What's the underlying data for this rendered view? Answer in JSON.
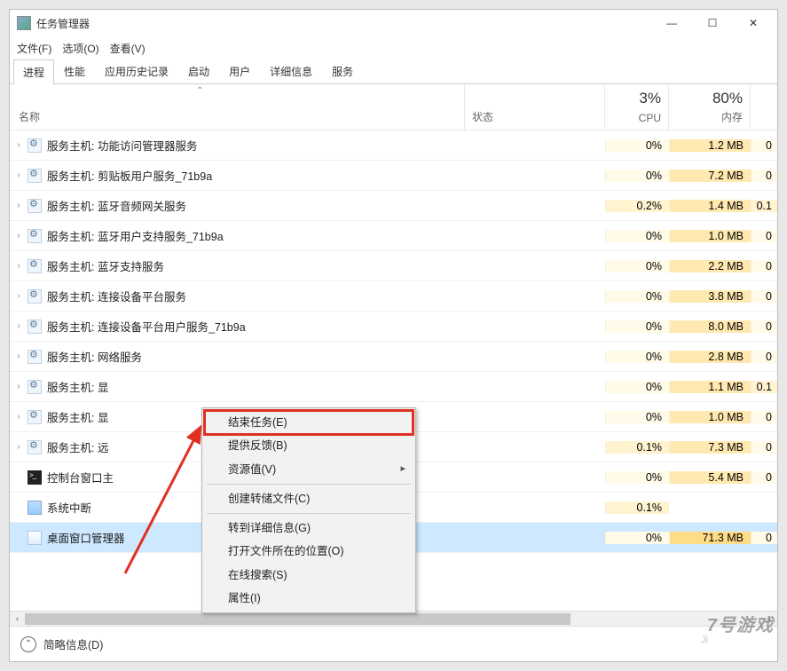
{
  "window": {
    "title": "任务管理器"
  },
  "menubar": [
    "文件(F)",
    "选项(O)",
    "查看(V)"
  ],
  "tabs": [
    "进程",
    "性能",
    "应用历史记录",
    "启动",
    "用户",
    "详细信息",
    "服务"
  ],
  "active_tab": 0,
  "headers": {
    "name": "名称",
    "status": "状态",
    "cpu_val": "3%",
    "cpu_lbl": "CPU",
    "mem_val": "80%",
    "mem_lbl": "内存"
  },
  "rows": [
    {
      "icon": "gear",
      "name": "服务主机: 功能访问管理器服务",
      "cpu": "0%",
      "cpu_h": 0,
      "mem": "1.2 MB",
      "mem_h": 2,
      "disk": "0",
      "disk_h": 0,
      "exp": true
    },
    {
      "icon": "gear",
      "name": "服务主机: 剪贴板用户服务_71b9a",
      "cpu": "0%",
      "cpu_h": 0,
      "mem": "7.2 MB",
      "mem_h": 2,
      "disk": "0",
      "disk_h": 0,
      "exp": true
    },
    {
      "icon": "gear",
      "name": "服务主机: 蓝牙音频网关服务",
      "cpu": "0.2%",
      "cpu_h": 1,
      "mem": "1.4 MB",
      "mem_h": 2,
      "disk": "0.1",
      "disk_h": 1,
      "exp": true
    },
    {
      "icon": "gear",
      "name": "服务主机: 蓝牙用户支持服务_71b9a",
      "cpu": "0%",
      "cpu_h": 0,
      "mem": "1.0 MB",
      "mem_h": 2,
      "disk": "0",
      "disk_h": 0,
      "exp": true
    },
    {
      "icon": "gear",
      "name": "服务主机: 蓝牙支持服务",
      "cpu": "0%",
      "cpu_h": 0,
      "mem": "2.2 MB",
      "mem_h": 2,
      "disk": "0",
      "disk_h": 0,
      "exp": true
    },
    {
      "icon": "gear",
      "name": "服务主机: 连接设备平台服务",
      "cpu": "0%",
      "cpu_h": 0,
      "mem": "3.8 MB",
      "mem_h": 2,
      "disk": "0",
      "disk_h": 0,
      "exp": true
    },
    {
      "icon": "gear",
      "name": "服务主机: 连接设备平台用户服务_71b9a",
      "cpu": "0%",
      "cpu_h": 0,
      "mem": "8.0 MB",
      "mem_h": 2,
      "disk": "0",
      "disk_h": 0,
      "exp": true
    },
    {
      "icon": "gear",
      "name": "服务主机: 网络服务",
      "cpu": "0%",
      "cpu_h": 0,
      "mem": "2.8 MB",
      "mem_h": 2,
      "disk": "0",
      "disk_h": 0,
      "exp": true
    },
    {
      "icon": "gear",
      "name": "服务主机: 显",
      "cpu": "0%",
      "cpu_h": 0,
      "mem": "1.1 MB",
      "mem_h": 2,
      "disk": "0.1",
      "disk_h": 1,
      "exp": true
    },
    {
      "icon": "gear",
      "name": "服务主机: 显",
      "cpu": "0%",
      "cpu_h": 0,
      "mem": "1.0 MB",
      "mem_h": 2,
      "disk": "0",
      "disk_h": 0,
      "exp": true
    },
    {
      "icon": "gear",
      "name": "服务主机: 远",
      "cpu": "0.1%",
      "cpu_h": 1,
      "mem": "7.3 MB",
      "mem_h": 2,
      "disk": "0",
      "disk_h": 0,
      "exp": true
    },
    {
      "icon": "console",
      "name": "控制台窗口主",
      "cpu": "0%",
      "cpu_h": 0,
      "mem": "5.4 MB",
      "mem_h": 2,
      "disk": "0",
      "disk_h": 0,
      "exp": false
    },
    {
      "icon": "sys",
      "name": "系统中断",
      "cpu": "0.1%",
      "cpu_h": 1,
      "mem": "",
      "mem_h": 2,
      "disk": "",
      "disk_h": 0,
      "exp": false
    },
    {
      "icon": "dwm",
      "name": "桌面窗口管理器",
      "cpu": "0%",
      "cpu_h": 0,
      "mem": "71.3 MB",
      "mem_h": 3,
      "disk": "0",
      "disk_h": 0,
      "exp": false,
      "selected": true
    }
  ],
  "context_menu": [
    {
      "label": "结束任务(E)",
      "hl": true
    },
    {
      "label": "提供反馈(B)"
    },
    {
      "label": "资源值(V)",
      "sub": true
    },
    {
      "sep": true
    },
    {
      "label": "创建转储文件(C)"
    },
    {
      "sep": true
    },
    {
      "label": "转到详细信息(G)"
    },
    {
      "label": "打开文件所在的位置(O)"
    },
    {
      "label": "在线搜索(S)"
    },
    {
      "label": "属性(I)"
    }
  ],
  "footer": {
    "label": "简略信息(D)"
  },
  "watermark": "7号游戏",
  "watermark2": "Ji"
}
